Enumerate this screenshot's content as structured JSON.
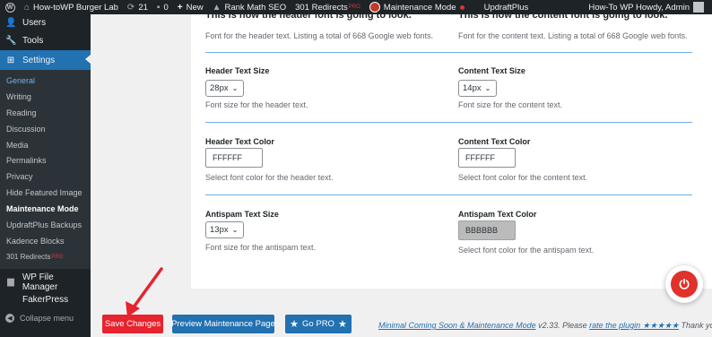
{
  "adminbar": {
    "site_name": "How-toWP Burger Lab",
    "updates_count": "21",
    "comments_count": "0",
    "new_label": "New",
    "rankmath_label": "Rank Math SEO",
    "redirects_label": "301 Redirects",
    "redirects_badge": "PRO",
    "maintenance_label": "Maintenance Mode",
    "updraft_label": "UpdraftPlus",
    "howdy_label": "How-To WP Howdy, Admin"
  },
  "sidebar": {
    "top_items": [
      {
        "label": "Users",
        "icon": "users-icon"
      },
      {
        "label": "Tools",
        "icon": "tools-icon"
      },
      {
        "label": "Settings",
        "icon": "settings-icon"
      }
    ],
    "sub_items": [
      {
        "label": "General"
      },
      {
        "label": "Writing"
      },
      {
        "label": "Reading"
      },
      {
        "label": "Discussion"
      },
      {
        "label": "Media"
      },
      {
        "label": "Permalinks"
      },
      {
        "label": "Privacy"
      },
      {
        "label": "Hide Featured Image"
      },
      {
        "label": "Maintenance Mode"
      },
      {
        "label": "UpdraftPlus Backups"
      },
      {
        "label": "Kadence Blocks"
      },
      {
        "label": "301 Redirects",
        "badge": "PRO"
      }
    ],
    "bottom_items": [
      {
        "label": "WP File Manager",
        "icon": "file-manager-icon"
      },
      {
        "label": "FakerPress",
        "icon": "fakerpress-icon"
      }
    ],
    "collapse_label": "Collapse menu"
  },
  "settings": {
    "header_font_cut": "This is how the header font is going to look.",
    "content_font_cut": "This is how the content font is going to look.",
    "header_font_desc": "Font for the header text. Listing a total of 668 Google web fonts.",
    "content_font_desc": "Font for the content text. Listing a total of 668 Google web fonts.",
    "header_size_label": "Header Text Size",
    "header_size_value": "28px",
    "header_size_desc": "Font size for the header text.",
    "content_size_label": "Content Text Size",
    "content_size_value": "14px",
    "content_size_desc": "Font size for the content text.",
    "header_color_label": "Header Text Color",
    "header_color_value": "FFFFFF",
    "header_color_desc": "Select font color for the header text.",
    "content_color_label": "Content Text Color",
    "content_color_value": "FFFFFF",
    "content_color_desc": "Select font color for the content text.",
    "antispam_size_label": "Antispam Text Size",
    "antispam_size_value": "13px",
    "antispam_size_desc": "Font size for the antispam text.",
    "antispam_color_label": "Antispam Text Color",
    "antispam_color_value": "BBBBBB",
    "antispam_color_desc": "Select font color for the antispam text."
  },
  "footer": {
    "save_label": "Save Changes",
    "preview_label": "Preview Maintenance Page",
    "pro_label": "Go PRO",
    "plugin_link": "Minimal Coming Soon & Maintenance Mode",
    "version_text": " v2.33. Please ",
    "rate_link": "rate the plugin ★★★★★",
    "thanks_text": " Thank you!"
  },
  "colors": {
    "save_button": "#e6232e",
    "primary_button": "#2271b1",
    "divider": "#72aee6",
    "sidebar_bg": "#1d2327",
    "active_menu": "#2271b1",
    "antispam_swatch": "#bbbbbb"
  }
}
